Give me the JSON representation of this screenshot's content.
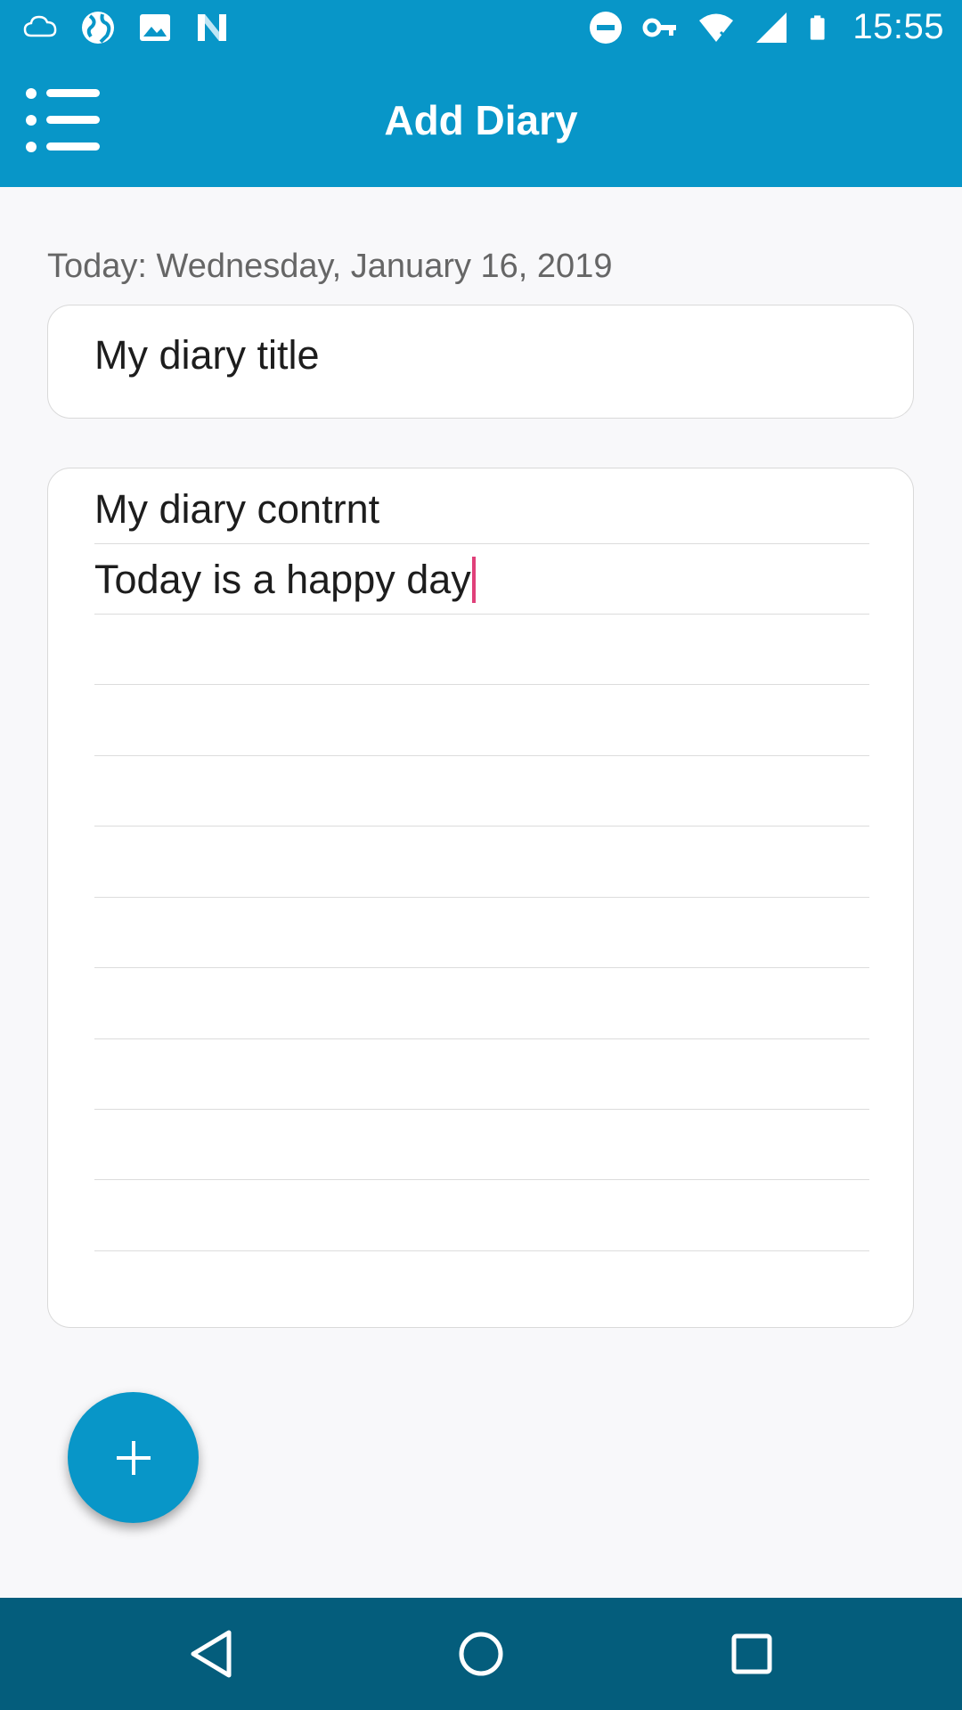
{
  "status_bar": {
    "time": "15:55",
    "left_icons": [
      "cloud-icon",
      "globe-icon",
      "image-icon",
      "n-app-icon"
    ],
    "right_icons": [
      "do-not-disturb-icon",
      "vpn-key-icon",
      "wifi-icon",
      "cell-signal-icon",
      "battery-icon"
    ]
  },
  "app_bar": {
    "title": "Add Diary",
    "menu_icon": "menu-list-icon"
  },
  "date_label": "Today: Wednesday, January 16, 2019",
  "title_field": {
    "value": "My diary title"
  },
  "content": {
    "lines": [
      "My diary contrnt",
      "Today is a happy day",
      "",
      "",
      "",
      "",
      "",
      "",
      "",
      "",
      "",
      ""
    ]
  },
  "fab": {
    "icon": "plus-icon"
  },
  "nav_bar": {
    "buttons": [
      "back-icon",
      "home-icon",
      "recents-icon"
    ]
  },
  "colors": {
    "primary": "#0896c8",
    "nav_bar": "#045d7c",
    "caret": "#e0407a",
    "background": "#f8f8fa"
  }
}
